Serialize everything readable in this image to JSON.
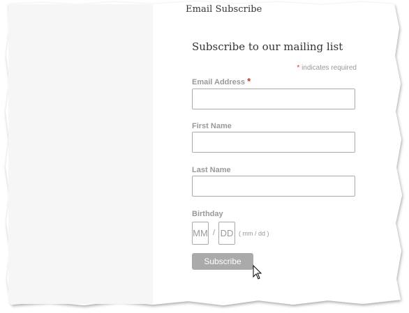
{
  "widget": {
    "title": "Email Subscribe"
  },
  "form": {
    "heading": "Subscribe to our mailing list",
    "required_marker": "*",
    "required_note": "indicates required",
    "fields": {
      "email": {
        "label": "Email Address",
        "value": ""
      },
      "first_name": {
        "label": "First Name",
        "value": ""
      },
      "last_name": {
        "label": "Last Name",
        "value": ""
      },
      "birthday": {
        "label": "Birthday",
        "month_placeholder": "MM",
        "separator": "/",
        "day_placeholder": "DD",
        "hint": "( mm / dd )"
      }
    },
    "submit_label": "Subscribe"
  },
  "colors": {
    "label": "#999999",
    "required": "#c0392b",
    "button": "#aaaaaa",
    "left_pane": "#f6f6f6"
  },
  "icons": {
    "cursor": "mouse-pointer-icon"
  }
}
